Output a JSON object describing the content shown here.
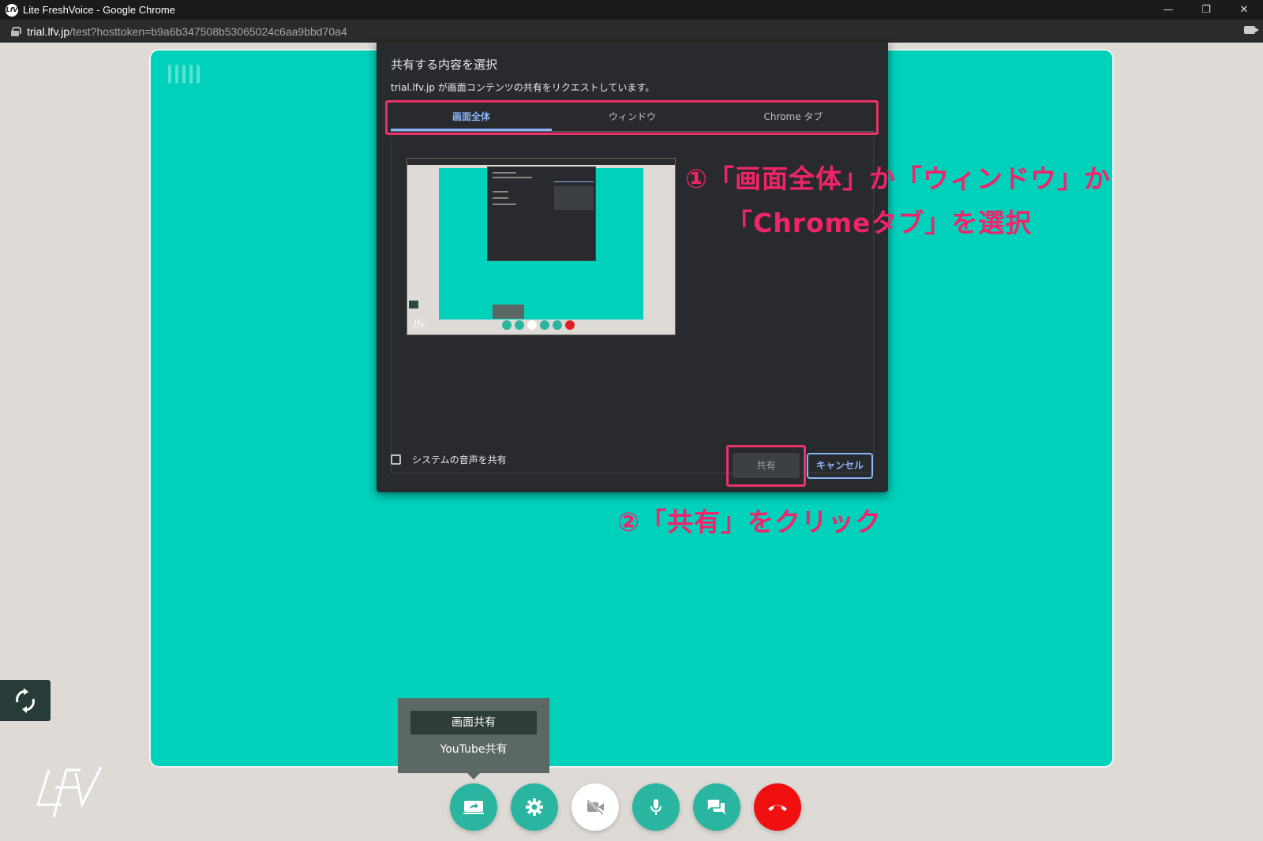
{
  "window": {
    "title": "Lite FreshVoice - Google Chrome",
    "logo_text": "LfV",
    "minimize": "—",
    "restore": "❐",
    "close": "✕"
  },
  "address": {
    "host": "trial.lfv.jp",
    "path": "/test?hosttoken=b9a6b347508b53065024c6aa9bbd70a4"
  },
  "dialog": {
    "title": "共有する内容を選択",
    "subtitle": "trial.lfv.jp が画面コンテンツの共有をリクエストしています。",
    "tabs": [
      {
        "label": "画面全体",
        "active": true
      },
      {
        "label": "ウィンドウ",
        "active": false
      },
      {
        "label": "Chrome タブ",
        "active": false
      }
    ],
    "checkbox_label": "システムの音声を共有",
    "share_button": "共有",
    "cancel_button": "キャンセル"
  },
  "annotations": {
    "step1_line1": "①「画面全体」か「ウィンドウ」か",
    "step1_line2": "「Chromeタブ」を選択",
    "step2": "②「共有」をクリック",
    "color": "#f0246a"
  },
  "popup": {
    "items": [
      "画面共有",
      "YouTube共有"
    ]
  },
  "controls": [
    {
      "name": "screen-share",
      "icon": "screen-share-icon"
    },
    {
      "name": "settings",
      "icon": "gear-icon"
    },
    {
      "name": "camera-off",
      "icon": "video-off-icon"
    },
    {
      "name": "microphone",
      "icon": "mic-icon"
    },
    {
      "name": "chat",
      "icon": "chat-icon"
    },
    {
      "name": "hang-up",
      "icon": "phone-hangup-icon"
    }
  ],
  "colors": {
    "stage": "#00d1bb",
    "control": "#2ab5a0",
    "hangup": "#f01010",
    "accent": "#8ab4f8"
  }
}
